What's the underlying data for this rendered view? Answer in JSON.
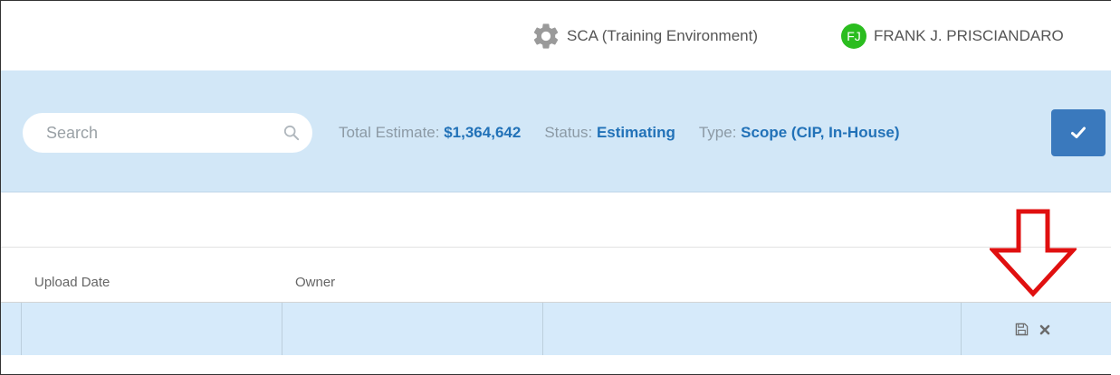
{
  "header": {
    "environment_label": "SCA (Training Environment)",
    "user_initials": "FJ",
    "user_name": "FRANK J. PRISCIANDARO"
  },
  "search": {
    "placeholder": "Search"
  },
  "summary": {
    "total_label": "Total Estimate: ",
    "total_value": "$1,364,642",
    "status_label": "Status: ",
    "status_value": "Estimating",
    "type_label": "Type: ",
    "type_value": "Scope (CIP, In-House)"
  },
  "table": {
    "columns": [
      "Upload Date",
      "Owner"
    ]
  },
  "icons": {
    "settings": "gear-icon",
    "search": "search-icon",
    "confirm": "check-icon",
    "save": "floppy-save-icon",
    "delete": "close-icon",
    "annotation": "down-arrow-annotation"
  },
  "colors": {
    "band": "#d2e7f7",
    "accent": "#2272b8",
    "button": "#3a79bd",
    "avatar": "#2bbd1f",
    "row": "#d6eafa",
    "annotation": "#e01010"
  }
}
